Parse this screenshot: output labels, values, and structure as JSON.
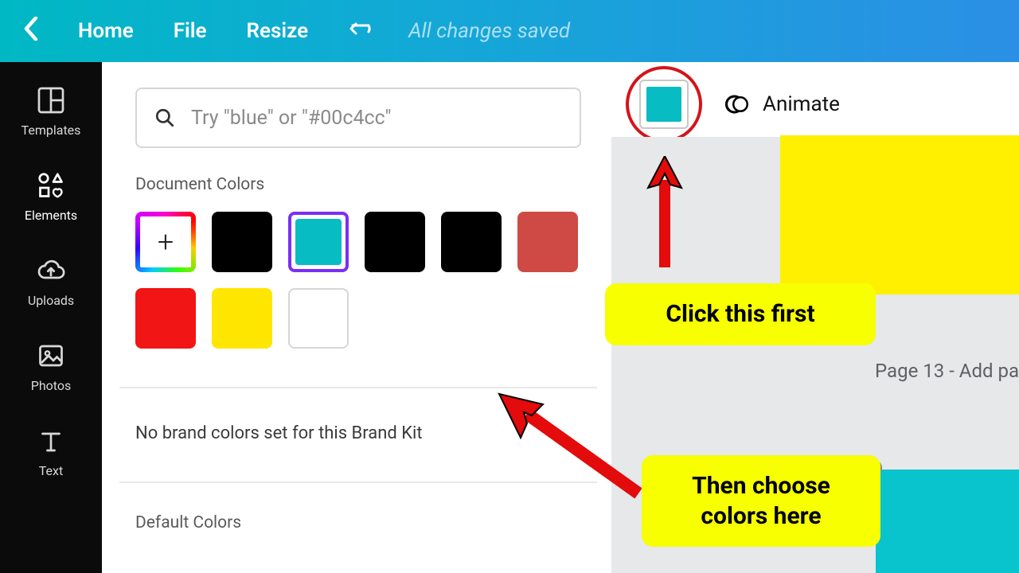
{
  "topbar": {
    "home": "Home",
    "file": "File",
    "resize": "Resize",
    "status": "All changes saved"
  },
  "sidebar": {
    "templates": "Templates",
    "elements": "Elements",
    "uploads": "Uploads",
    "photos": "Photos",
    "text": "Text"
  },
  "panel": {
    "search_placeholder": "Try \"blue\" or \"#00c4cc\"",
    "doc_colors_title": "Document Colors",
    "brand_kit_msg": "No brand colors set for this Brand Kit",
    "default_colors_title": "Default Colors",
    "colors": {
      "selected": "#08bcc4",
      "black1": "#000000",
      "black2": "#000000",
      "black3": "#000000",
      "redmuted": "#cf4a44",
      "red": "#f21515",
      "yellow": "#ffe600",
      "white": "#ffffff"
    }
  },
  "contextbar": {
    "animate": "Animate",
    "current_color": "#08bcc4"
  },
  "canvas": {
    "page_label": "Page 13 - Add pa"
  },
  "annotations": {
    "step1": "Click this first",
    "step2": "Then choose colors here"
  }
}
